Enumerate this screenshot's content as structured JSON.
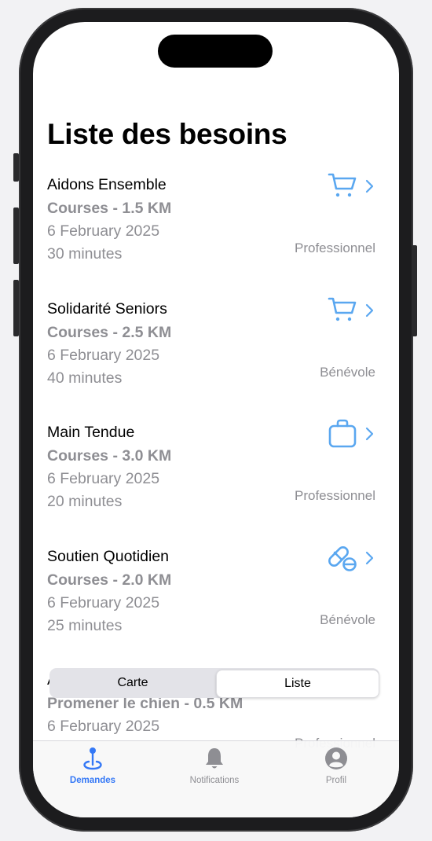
{
  "page": {
    "title": "Liste des besoins"
  },
  "colors": {
    "accent": "#3478f6",
    "icon_blue": "#5aa7f0",
    "secondary_text": "#8e8e93"
  },
  "needs": [
    {
      "organization": "Aidons Ensemble",
      "task": "Courses - 1.5 KM",
      "date": "6 February 2025",
      "duration": "30 minutes",
      "provider_type": "Professionnel",
      "icon": "cart-icon"
    },
    {
      "organization": "Solidarité Seniors",
      "task": "Courses - 2.5 KM",
      "date": "6 February 2025",
      "duration": "40 minutes",
      "provider_type": "Bénévole",
      "icon": "cart-icon"
    },
    {
      "organization": "Main Tendue",
      "task": "Courses - 3.0 KM",
      "date": "6 February 2025",
      "duration": "20 minutes",
      "provider_type": "Professionnel",
      "icon": "bag-icon"
    },
    {
      "organization": "Soutien Quotidien",
      "task": "Courses - 2.0 KM",
      "date": "6 February 2025",
      "duration": "25 minutes",
      "provider_type": "Bénévole",
      "icon": "pills-icon"
    },
    {
      "organization": "A",
      "task": "Promener le chien - 0.5 KM",
      "date": "6 February 2025",
      "duration": "",
      "provider_type": "Professionnel",
      "icon": "paw-icon"
    }
  ],
  "segmented_control": {
    "options": [
      "Carte",
      "Liste"
    ],
    "selected": "Liste"
  },
  "tabbar": {
    "selected": "Demandes",
    "tabs": [
      {
        "label": "Demandes",
        "icon": "map-pin-icon"
      },
      {
        "label": "Notifications",
        "icon": "bell-icon"
      },
      {
        "label": "Profil",
        "icon": "person-circle-icon"
      }
    ]
  }
}
